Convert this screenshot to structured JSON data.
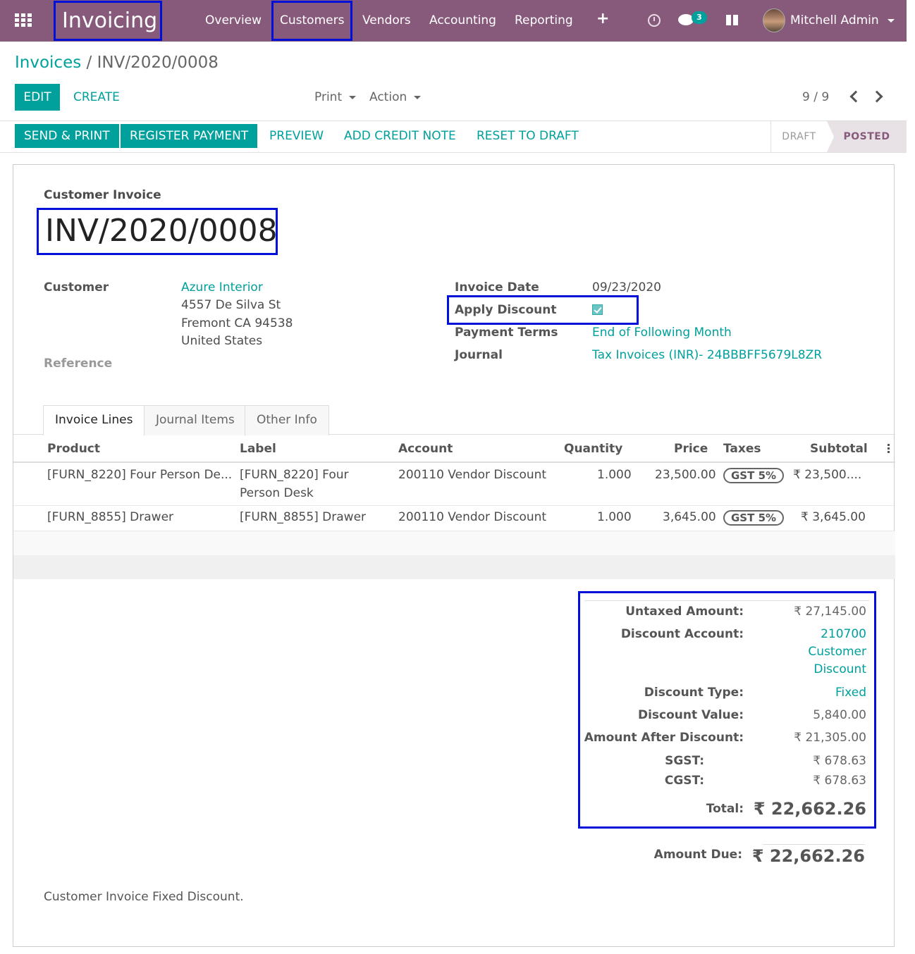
{
  "nav": {
    "app_name": "Invoicing",
    "menu": [
      "Overview",
      "Customers",
      "Vendors",
      "Accounting",
      "Reporting"
    ],
    "message_count": "3",
    "user_name": "Mitchell Admin"
  },
  "control": {
    "breadcrumb_parent": "Invoices",
    "breadcrumb_sep": "/",
    "breadcrumb_current": "INV/2020/0008",
    "edit_label": "EDIT",
    "create_label": "CREATE",
    "print_label": "Print",
    "action_label": "Action",
    "pager": "9 / 9"
  },
  "statusbar": {
    "buttons": [
      "SEND & PRINT",
      "REGISTER PAYMENT",
      "PREVIEW",
      "ADD CREDIT NOTE",
      "RESET TO DRAFT"
    ],
    "stages": [
      "DRAFT",
      "POSTED"
    ],
    "active_stage": "POSTED"
  },
  "invoice": {
    "type": "Customer Invoice",
    "name": "INV/2020/0008",
    "customer_label": "Customer",
    "customer_name": "Azure Interior",
    "address": [
      "4557 De Silva St",
      "Fremont CA 94538",
      "United States"
    ],
    "reference_label": "Reference",
    "invoice_date_label": "Invoice Date",
    "invoice_date": "09/23/2020",
    "apply_discount_label": "Apply Discount",
    "apply_discount_checked": true,
    "payment_terms_label": "Payment Terms",
    "payment_terms": "End of Following Month",
    "journal_label": "Journal",
    "journal": "Tax Invoices (INR)- 24BBBFF5679L8ZR",
    "note": "Customer Invoice Fixed Discount."
  },
  "tabs": [
    "Invoice Lines",
    "Journal Items",
    "Other Info"
  ],
  "lines": {
    "columns": [
      "Product",
      "Label",
      "Account",
      "Quantity",
      "Price",
      "Taxes",
      "Subtotal"
    ],
    "rows": [
      {
        "product": "[FURN_8220] Four Person De...",
        "label1": "[FURN_8220] Four",
        "label2": "Person Desk",
        "account": "200110 Vendor Discount",
        "quantity": "1.000",
        "price": "23,500.00",
        "tax": "GST 5%",
        "subtotal": "₹ 23,500...."
      },
      {
        "product": "[FURN_8855] Drawer",
        "label1": "[FURN_8855] Drawer",
        "label2": "",
        "account": "200110 Vendor Discount",
        "quantity": "1.000",
        "price": "3,645.00",
        "tax": "GST 5%",
        "subtotal": "₹ 3,645.00"
      }
    ]
  },
  "totals": {
    "untaxed_label": "Untaxed Amount:",
    "untaxed": "₹ 27,145.00",
    "discount_account_label": "Discount Account:",
    "discount_account": [
      "210700",
      "Customer",
      "Discount"
    ],
    "discount_type_label": "Discount Type:",
    "discount_type": "Fixed",
    "discount_value_label": "Discount Value:",
    "discount_value": "5,840.00",
    "after_discount_label": "Amount After Discount:",
    "after_discount": "₹ 21,305.00",
    "sgst_label": "SGST:",
    "sgst": "₹ 678.63",
    "cgst_label": "CGST:",
    "cgst": "₹ 678.63",
    "total_label": "Total:",
    "total": "₹ 22,662.26",
    "due_label": "Amount Due:",
    "due": "₹ 22,662.26"
  },
  "colors": {
    "brand": "#875a7b",
    "accent": "#00a09d",
    "highlight_box": "#0010d8"
  }
}
